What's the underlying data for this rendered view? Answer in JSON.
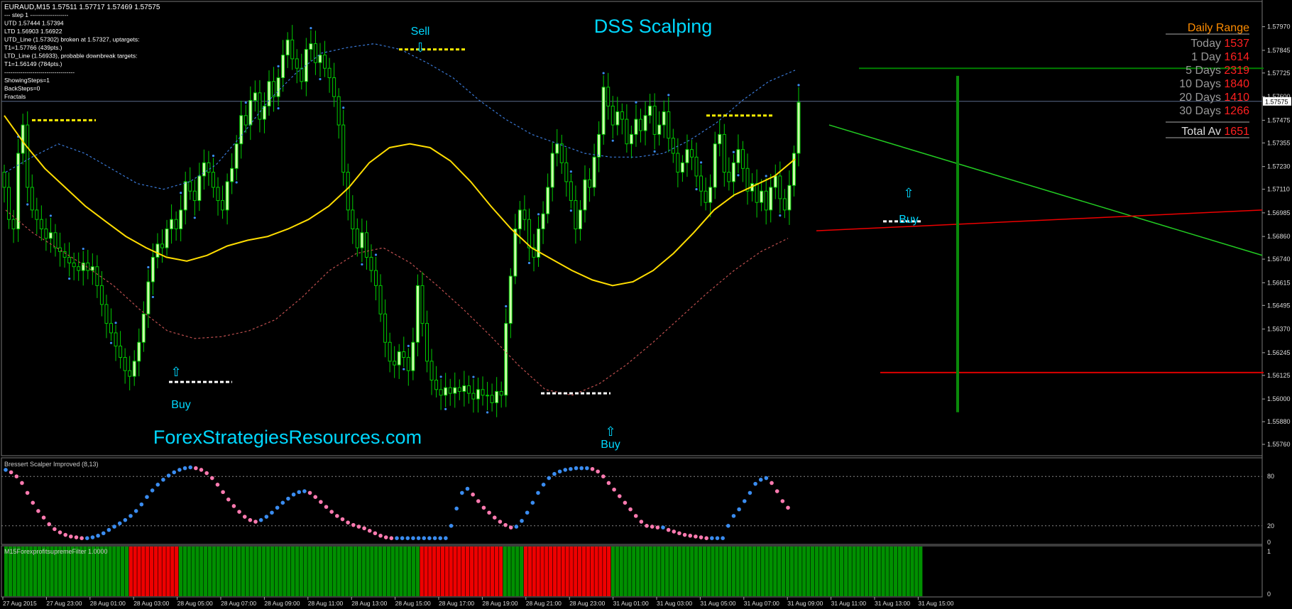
{
  "chart_data": [
    {
      "type": "candlestick",
      "symbol_line": "EURAUD,M15  1.57511 1.57717 1.57469 1.57575",
      "title": "DSS Scalping",
      "watermark": "ForexStrategiesResources.com",
      "info_lines": [
        "---  step 1  -------------------",
        "UTD 1.57444 1.57394",
        "LTD 1.56903 1.56922",
        "UTD_Line (1.57302) broken at 1.57327, uptargets:",
        "T1=1.57766 (439pts.)",
        "LTD_Line (1.56933), probable downbreak targets:",
        "T1=1.56149 (784pts.)",
        "-----------------------------------",
        "ShowingSteps=1",
        "BackSteps=0",
        "Fractals"
      ],
      "ylim": [
        1.557,
        1.581
      ],
      "y_ticks": [
        "1.57970",
        "1.57845",
        "1.57725",
        "1.57600",
        "1.57475",
        "1.57355",
        "1.57230",
        "1.57110",
        "1.56985",
        "1.56860",
        "1.56740",
        "1.56615",
        "1.56495",
        "1.56370",
        "1.56245",
        "1.56125",
        "1.56000",
        "1.55880",
        "1.55760"
      ],
      "current_price": "1.57575",
      "daily_range": {
        "title": "Daily Range",
        "rows": [
          {
            "label": "Today",
            "value": "1537"
          },
          {
            "label": "1 Day",
            "value": "1614"
          },
          {
            "label": "5 Days",
            "value": "2319"
          },
          {
            "label": "10 Days",
            "value": "1840"
          },
          {
            "label": "20 Days",
            "value": "1410"
          },
          {
            "label": "30 Days",
            "value": "1266"
          }
        ],
        "total_label": "Total Av",
        "total_value": "1651"
      },
      "annotations": [
        {
          "text": "Sell",
          "arrow": "⇩"
        },
        {
          "text": "Buy",
          "arrow": "⇧"
        },
        {
          "text": "Buy",
          "arrow": "⇧"
        },
        {
          "text": "Buy",
          "arrow": "⇧"
        }
      ],
      "series": {
        "close": [
          1.5712,
          1.5695,
          1.569,
          1.573,
          1.5745,
          1.5712,
          1.57,
          1.5695,
          1.569,
          1.5685,
          1.5688,
          1.568,
          1.5678,
          1.5675,
          1.5672,
          1.567,
          1.5668,
          1.5672,
          1.5668,
          1.567,
          1.566,
          1.565,
          1.564,
          1.5635,
          1.5628,
          1.5622,
          1.5615,
          1.5612,
          1.562,
          1.563,
          1.5645,
          1.5662,
          1.5675,
          1.5682,
          1.568,
          1.569,
          1.5695,
          1.569,
          1.57,
          1.5715,
          1.571,
          1.5705,
          1.5718,
          1.5725,
          1.572,
          1.5712,
          1.5705,
          1.57,
          1.5715,
          1.5722,
          1.5735,
          1.575,
          1.5745,
          1.5758,
          1.5762,
          1.5748,
          1.5755,
          1.5768,
          1.576,
          1.577,
          1.5782,
          1.579,
          1.578,
          1.5775,
          1.5768,
          1.5785,
          1.5788,
          1.5778,
          1.5782,
          1.5775,
          1.577,
          1.576,
          1.5745,
          1.572,
          1.57,
          1.569,
          1.568,
          1.5688,
          1.5675,
          1.5668,
          1.566,
          1.5645,
          1.563,
          1.562,
          1.5618,
          1.5625,
          1.5622,
          1.5615,
          1.563,
          1.566,
          1.564,
          1.562,
          1.561,
          1.5605,
          1.5602,
          1.5606,
          1.5603,
          1.5606,
          1.5604,
          1.5607,
          1.5603,
          1.56,
          1.5605,
          1.5602,
          1.5602,
          1.5598,
          1.5604,
          1.5602,
          1.564,
          1.5665,
          1.569,
          1.57,
          1.5695,
          1.568,
          1.5675,
          1.569,
          1.5698,
          1.5712,
          1.573,
          1.5735,
          1.5725,
          1.5715,
          1.5705,
          1.569,
          1.57,
          1.5716,
          1.5712,
          1.5728,
          1.574,
          1.5765,
          1.5755,
          1.5745,
          1.5752,
          1.5748,
          1.5735,
          1.574,
          1.5748,
          1.5742,
          1.575,
          1.5755,
          1.574,
          1.5745,
          1.5752,
          1.5738,
          1.573,
          1.572,
          1.5725,
          1.5732,
          1.5728,
          1.5718,
          1.571,
          1.5704,
          1.5712,
          1.5735,
          1.574,
          1.572,
          1.5715,
          1.5725,
          1.5732,
          1.5722,
          1.571,
          1.5714,
          1.5704,
          1.571,
          1.57,
          1.5712,
          1.5718,
          1.5706,
          1.57,
          1.5713,
          1.573,
          1.5757
        ],
        "ma": [
          1.575,
          1.5735,
          1.5722,
          1.5712,
          1.5702,
          1.5694,
          1.5686,
          1.568,
          1.5675,
          1.5673,
          1.5676,
          1.5681,
          1.5684,
          1.5686,
          1.569,
          1.5695,
          1.5702,
          1.5712,
          1.5725,
          1.5733,
          1.5735,
          1.5733,
          1.5726,
          1.5715,
          1.5702,
          1.569,
          1.568,
          1.5674,
          1.5668,
          1.5663,
          1.566,
          1.5662,
          1.5668,
          1.5677,
          1.5688,
          1.57,
          1.5708,
          1.5713,
          1.5718,
          1.5727
        ],
        "upper_band": [
          1.572,
          1.5728,
          1.5735,
          1.573,
          1.5722,
          1.5714,
          1.5711,
          1.5715,
          1.5724,
          1.574,
          1.5758,
          1.5772,
          1.5783,
          1.5786,
          1.5788,
          1.5785,
          1.5778,
          1.577,
          1.5758,
          1.5748,
          1.574,
          1.5735,
          1.573,
          1.5728,
          1.5728,
          1.573,
          1.5737,
          1.5746,
          1.5758,
          1.5768,
          1.5774
        ],
        "lower_band": [
          1.57,
          1.5688,
          1.5679,
          1.567,
          1.566,
          1.5647,
          1.5636,
          1.5632,
          1.5633,
          1.5636,
          1.5642,
          1.5654,
          1.5668,
          1.5677,
          1.568,
          1.5672,
          1.566,
          1.5647,
          1.5633,
          1.5618,
          1.5605,
          1.5602,
          1.5608,
          1.5618,
          1.563,
          1.5643,
          1.5656,
          1.5668,
          1.5678,
          1.5685
        ]
      },
      "hlines": [
        {
          "color": "#ffee00",
          "style": "dashed",
          "price": 1.57475
        },
        {
          "color": "#ffee00",
          "style": "dashed",
          "price": 1.5785
        },
        {
          "color": "#ffee00",
          "style": "dashed",
          "price": 1.575
        },
        {
          "color": "#ffffff",
          "style": "dashed",
          "price": 1.5609
        },
        {
          "color": "#ffffff",
          "style": "dashed",
          "price": 1.5603
        },
        {
          "color": "#ffffff",
          "style": "dashed",
          "price": 1.5694
        },
        {
          "color": "#008000",
          "style": "solid",
          "price": 1.5775
        },
        {
          "color": "#dd0000",
          "style": "solid",
          "price": 1.5614
        }
      ],
      "x_labels": [
        "27 Aug 2015",
        "27 Aug 23:00",
        "28 Aug 01:00",
        "28 Aug 03:00",
        "28 Aug 05:00",
        "28 Aug 07:00",
        "28 Aug 09:00",
        "28 Aug 11:00",
        "28 Aug 13:00",
        "28 Aug 15:00",
        "28 Aug 17:00",
        "28 Aug 19:00",
        "28 Aug 21:00",
        "28 Aug 23:00",
        "31 Aug 01:00",
        "31 Aug 03:00",
        "31 Aug 05:00",
        "31 Aug 07:00",
        "31 Aug 09:00",
        "31 Aug 11:00",
        "31 Aug 13:00",
        "31 Aug 15:00"
      ],
      "colors": {
        "candle": "#00cc00",
        "body_up": "#ccffaa",
        "ma": "#ffdd00",
        "upper_band": "#3a7ad8",
        "lower_band": "#c05050",
        "grid": "#5a6a8a"
      }
    },
    {
      "type": "scatter",
      "title": "Bressert Scalper Improved (8,13)",
      "ylim": [
        0,
        100
      ],
      "levels": [
        "80",
        "20",
        "0"
      ],
      "values": [
        88,
        85,
        80,
        72,
        60,
        48,
        38,
        30,
        22,
        16,
        12,
        9,
        7,
        6,
        5,
        5,
        6,
        8,
        11,
        15,
        19,
        23,
        27,
        32,
        38,
        46,
        55,
        63,
        70,
        76,
        81,
        85,
        88,
        90,
        91,
        90,
        88,
        84,
        78,
        70,
        61,
        52,
        44,
        37,
        31,
        27,
        25,
        27,
        31,
        36,
        42,
        48,
        53,
        58,
        61,
        62,
        60,
        55,
        49,
        43,
        37,
        32,
        28,
        24,
        21,
        19,
        17,
        14,
        11,
        8,
        6,
        5,
        5,
        5,
        5,
        5,
        5,
        5,
        5,
        5,
        5,
        5,
        20,
        41,
        60,
        65,
        58,
        50,
        42,
        36,
        30,
        25,
        21,
        18,
        19,
        26,
        36,
        48,
        60,
        70,
        78,
        83,
        86,
        88,
        89,
        90,
        90,
        90,
        89,
        86,
        80,
        72,
        64,
        56,
        48,
        40,
        32,
        25,
        20,
        19,
        18,
        18,
        15,
        13,
        11,
        9,
        8,
        7,
        6,
        5,
        5,
        5,
        5,
        20,
        32,
        40,
        50,
        60,
        71,
        76,
        78,
        72,
        62,
        50,
        42
      ],
      "up_color": "#3a8cf0",
      "down_color": "#ff7ab0"
    },
    {
      "type": "bar",
      "title": "M15ForexprofitsupremeFilter 1.0000",
      "levels": [
        "1",
        "0"
      ],
      "segments": [
        {
          "state": "green",
          "bars": 30
        },
        {
          "state": "red",
          "bars": 12
        },
        {
          "state": "green",
          "bars": 58
        },
        {
          "state": "red",
          "bars": 20
        },
        {
          "state": "green",
          "bars": 5
        },
        {
          "state": "red",
          "bars": 21
        },
        {
          "state": "green",
          "bars": 75
        }
      ],
      "colors": {
        "green": "#009000",
        "red": "#ee0000"
      }
    }
  ]
}
